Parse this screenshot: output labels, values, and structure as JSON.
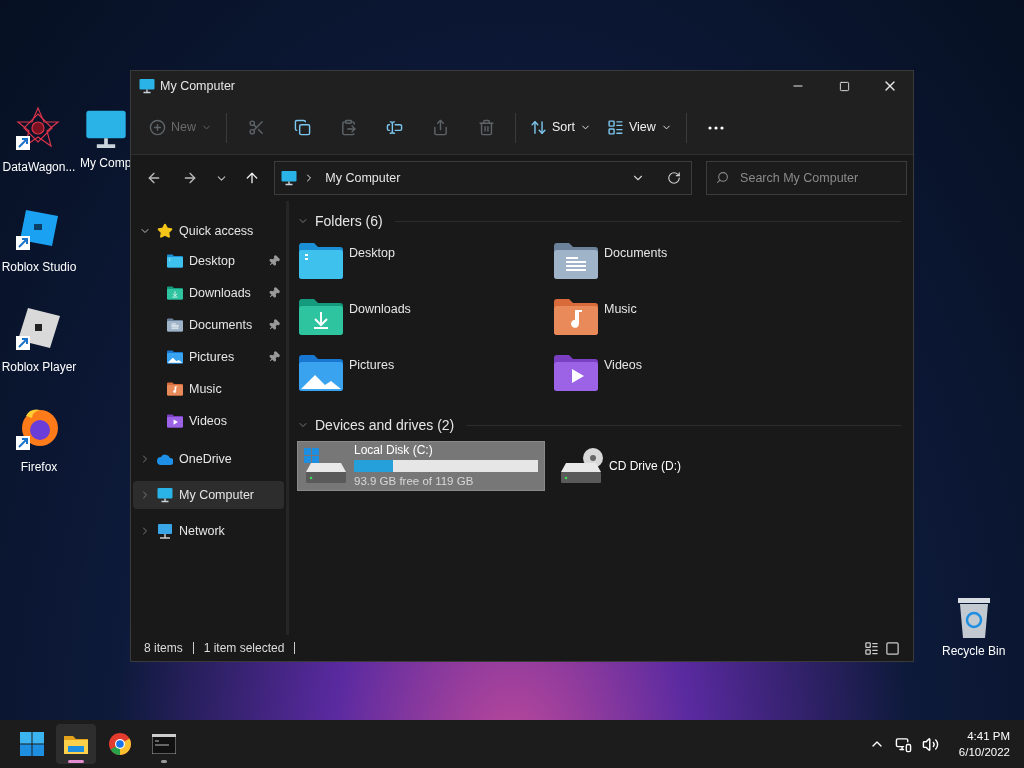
{
  "desktop_icons": [
    {
      "kind": "star",
      "label": "DataWagon...",
      "shortcut": true
    },
    {
      "kind": "studio",
      "label": "Roblox Studio",
      "shortcut": true
    },
    {
      "kind": "player",
      "label": "Roblox Player",
      "shortcut": true
    },
    {
      "kind": "firefox",
      "label": "Firefox",
      "shortcut": true
    }
  ],
  "covered_icon": {
    "label": "My Comp"
  },
  "recycle_bin": {
    "label": "Recycle Bin"
  },
  "window": {
    "title": "My Computer",
    "toolbar": [
      {
        "kind": "new",
        "label": "New",
        "disabled": true
      },
      {
        "kind": "cut",
        "disabled": true
      },
      {
        "kind": "copy",
        "disabled": false
      },
      {
        "kind": "paste",
        "disabled": true
      },
      {
        "kind": "rename",
        "disabled": false
      },
      {
        "kind": "share",
        "disabled": true
      },
      {
        "kind": "delete",
        "disabled": true
      },
      {
        "kind": "sort",
        "label": "Sort",
        "disabled": false
      },
      {
        "kind": "view",
        "label": "View",
        "disabled": false
      },
      {
        "kind": "more",
        "disabled": false
      }
    ],
    "address": {
      "path": "My Computer"
    },
    "search": {
      "placeholder": "Search My Computer"
    },
    "sidebar": [
      {
        "kind": "star",
        "label": "Quick access",
        "expanded": true,
        "selected": false,
        "children": [
          {
            "kind": "desktop",
            "label": "Desktop",
            "pinned": true,
            "selected": false
          },
          {
            "kind": "downloads",
            "label": "Downloads",
            "pinned": true,
            "selected": false
          },
          {
            "kind": "documents",
            "label": "Documents",
            "pinned": true,
            "selected": false
          },
          {
            "kind": "pictures",
            "label": "Pictures",
            "pinned": true,
            "selected": false
          },
          {
            "kind": "music",
            "label": "Music",
            "pinned": false,
            "selected": false
          },
          {
            "kind": "videos",
            "label": "Videos",
            "pinned": false,
            "selected": false
          }
        ]
      },
      {
        "kind": "cloud",
        "label": "OneDrive",
        "expanded": false,
        "selected": false
      },
      {
        "kind": "computer",
        "label": "My Computer",
        "expanded": false,
        "selected": true
      },
      {
        "kind": "network",
        "label": "Network",
        "expanded": false,
        "selected": false
      }
    ],
    "sections": [
      {
        "title": "Folders (6)",
        "expanded": true,
        "items": [
          {
            "kind": "desktop",
            "label": "Desktop"
          },
          {
            "kind": "documents",
            "label": "Documents"
          },
          {
            "kind": "downloads",
            "label": "Downloads"
          },
          {
            "kind": "music",
            "label": "Music"
          },
          {
            "kind": "pictures",
            "label": "Pictures"
          },
          {
            "kind": "videos",
            "label": "Videos"
          }
        ]
      },
      {
        "title": "Devices and drives (2)",
        "expanded": true,
        "items": [
          {
            "kind": "disk",
            "label": "Local Disk (C:)",
            "level": 0.21,
            "detail": "93.9 GB free of 119 GB",
            "selected": true
          },
          {
            "kind": "cd",
            "label": "CD Drive (D:)",
            "selected": false
          }
        ]
      }
    ],
    "status_bar": {
      "count": "8 items",
      "selection": "1 item selected"
    }
  },
  "taskbar": {
    "apps": [
      {
        "kind": "start",
        "active": false,
        "running": false
      },
      {
        "kind": "explorer",
        "active": true,
        "running": true
      },
      {
        "kind": "chrome",
        "active": false,
        "running": false
      },
      {
        "kind": "terminal",
        "active": false,
        "running": true
      }
    ],
    "time": "4:41 PM",
    "date": "6/10/2022"
  }
}
